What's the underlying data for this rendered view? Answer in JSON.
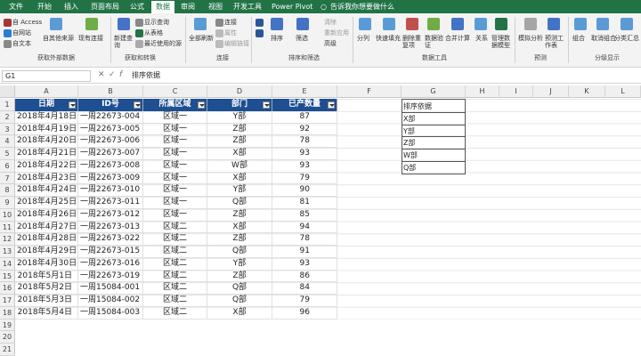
{
  "tabs": [
    "文件",
    "开始",
    "插入",
    "页面布局",
    "公式",
    "数据",
    "审阅",
    "视图",
    "开发工具",
    "Power Pivot",
    "告诉我你想要做什么"
  ],
  "ribbon": {
    "get_external": [
      "自 Access",
      "自网站",
      "自文本",
      "自其他来源",
      "现有连接"
    ],
    "new_query": "新建查询",
    "show_query": "显示查询",
    "from_table": "从表格",
    "recent_sources": "最近使用的源",
    "refresh_all": "全部刷新",
    "connections": "连接",
    "properties": "属性",
    "edit_links": "编辑链接",
    "sort": "排序",
    "filter": "筛选",
    "clear": "清除",
    "reapply": "重新应用",
    "advanced": "高级",
    "text_to_cols": "分列",
    "flash_fill": "快速填充",
    "remove_dups": "删除重复项",
    "data_validation": "数据验证",
    "consolidate": "合并计算",
    "relationships": "关系",
    "manage_model": "管理数据模型",
    "what_if": "模拟分析",
    "forecast_sheet": "预测工作表",
    "group": "组合",
    "ungroup": "取消组合",
    "subtotal": "分类汇总",
    "groups": [
      "获取外部数据",
      "获取和转换",
      "连接",
      "排序和筛选",
      "数据工具",
      "预测",
      "分级显示"
    ]
  },
  "namebox": "G1",
  "formula": "排序依据",
  "columns": [
    "A",
    "B",
    "C",
    "D",
    "E",
    "F",
    "G",
    "H",
    "I",
    "J",
    "K",
    "L"
  ],
  "rows": [
    "1",
    "2",
    "3",
    "4",
    "5",
    "6",
    "7",
    "8",
    "9",
    "10",
    "11",
    "12",
    "13",
    "14",
    "15",
    "16",
    "17",
    "18",
    "19",
    "20",
    "21"
  ],
  "table": {
    "headers": [
      "日期",
      "ID号",
      "所属区域",
      "部门",
      "已产数量"
    ],
    "data": [
      [
        "2018年4月18日",
        "一周22673-004",
        "区域一",
        "Y部",
        "87"
      ],
      [
        "2018年4月19日",
        "一周22673-005",
        "区域一",
        "Z部",
        "92"
      ],
      [
        "2018年4月20日",
        "一周22673-006",
        "区域一",
        "Z部",
        "78"
      ],
      [
        "2018年4月21日",
        "一周22673-007",
        "区域一",
        "X部",
        "93"
      ],
      [
        "2018年4月22日",
        "一周22673-008",
        "区域一",
        "W部",
        "93"
      ],
      [
        "2018年4月23日",
        "一周22673-009",
        "区域一",
        "X部",
        "79"
      ],
      [
        "2018年4月24日",
        "一周22673-010",
        "区域一",
        "Y部",
        "90"
      ],
      [
        "2018年4月25日",
        "一周22673-011",
        "区域一",
        "Q部",
        "81"
      ],
      [
        "2018年4月26日",
        "一周22673-012",
        "区域一",
        "Z部",
        "85"
      ],
      [
        "2018年4月27日",
        "一周22673-013",
        "区域二",
        "X部",
        "94"
      ],
      [
        "2018年4月28日",
        "一周22673-022",
        "区域二",
        "Z部",
        "78"
      ],
      [
        "2018年4月29日",
        "一周22673-015",
        "区域二",
        "Q部",
        "91"
      ],
      [
        "2018年4月30日",
        "一周22673-016",
        "区域二",
        "Y部",
        "93"
      ],
      [
        "2018年5月1日",
        "一周22673-019",
        "区域二",
        "Z部",
        "86"
      ],
      [
        "2018年5月2日",
        "一周15084-001",
        "区域二",
        "Q部",
        "84"
      ],
      [
        "2018年5月3日",
        "一周15084-002",
        "区域二",
        "Q部",
        "79"
      ],
      [
        "2018年5月4日",
        "一周15084-003",
        "区域二",
        "X部",
        "96"
      ]
    ]
  },
  "sort_list": [
    "排序依据",
    "X部",
    "Y部",
    "Z部",
    "W部",
    "Q部"
  ],
  "colors": {
    "brand": "#217346",
    "header_fill": "#1e4f91"
  }
}
